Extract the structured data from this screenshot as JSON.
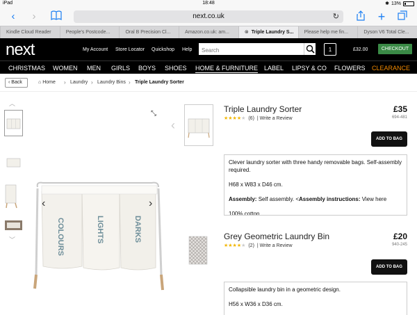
{
  "status": {
    "device": "iPad",
    "time": "18:48",
    "battery": "13%"
  },
  "browser": {
    "url": "next.co.uk",
    "tabs": [
      {
        "label": "Kindle Cloud Reader"
      },
      {
        "label": "People's Postcode..."
      },
      {
        "label": "Oral B Precision Cl..."
      },
      {
        "label": "Amazon.co.uk: am..."
      },
      {
        "label": "Triple Laundry S...",
        "active": true
      },
      {
        "label": "Please help me fin..."
      },
      {
        "label": "Dyson V6 Total Cle..."
      }
    ]
  },
  "header": {
    "logo": "next",
    "links": [
      "My Account",
      "Store Locator",
      "Quickshop",
      "Help"
    ],
    "search_placeholder": "Search",
    "bag_count": "1",
    "bag_total": "£32.00",
    "checkout": "CHECKOUT"
  },
  "nav": [
    "CHRISTMAS",
    "WOMEN",
    "MEN",
    "GIRLS",
    "BOYS",
    "SHOES",
    "HOME & FURNITURE",
    "LABEL",
    "LIPSY & CO",
    "FLOWERS",
    "CLEARANCE"
  ],
  "breadcrumb": {
    "back": "Back",
    "items": [
      "Home",
      "Laundry",
      "Laundry Bins",
      "Triple Laundry Sorter"
    ]
  },
  "gallery": {
    "bag_labels": [
      "COLOURS",
      "LIGHTS",
      "DARKS"
    ]
  },
  "products": [
    {
      "title": "Triple Laundry Sorter",
      "price": "£35",
      "code": "694-481",
      "rating": 4,
      "reviews": "(6)",
      "write_review": "| Write a Review",
      "add_to_bag": "ADD TO BAG",
      "desc": [
        "Clever laundry sorter with three handy removable bags. Self-assembly required.",
        "H68 x W83 x D46 cm."
      ],
      "assembly_label": "Assembly:",
      "assembly_text": " Self assembly. <",
      "instructions_label": "Assembly instructions:",
      "instructions_text": " View here",
      "material": "100% cotton."
    },
    {
      "title": "Grey Geometric Laundry Bin",
      "price": "£20",
      "code": "940-245",
      "rating": 4,
      "reviews": "(2)",
      "write_review": "| Write a Review",
      "add_to_bag": "ADD TO BAG",
      "desc": [
        "Collapsible laundry bin in a geometric design.",
        "H56 x W36 x D36 cm."
      ]
    }
  ],
  "colors": {
    "accent": "#1a7ef3",
    "checkout": "#3a8a46",
    "clearance": "#f28a00",
    "star": "#f2b600"
  }
}
